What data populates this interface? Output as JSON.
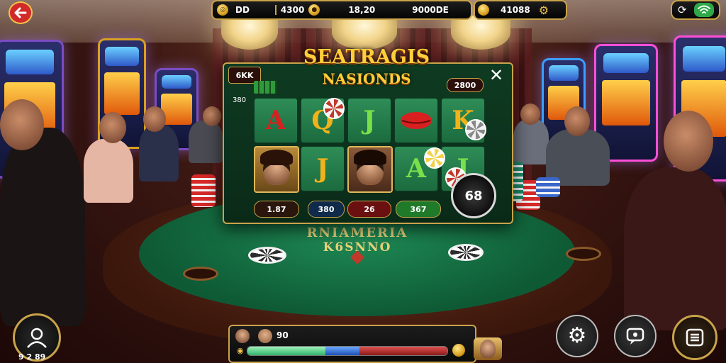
{
  "hud": {
    "top_left_value": "DD",
    "balance_value": "4300",
    "center_value": "18,20",
    "right_value": "9000DE",
    "coins_value": "41088",
    "coin_glyph_1": "◎",
    "coin_glyph_2": "●"
  },
  "slot_panel": {
    "title_line_1": "SEATRAGIS",
    "title_line_2": "NASIONDS",
    "top_left_box": "6KK",
    "top_right_box": "2800",
    "side_number": "380",
    "close_label": "✕",
    "reels_row_1": [
      "A",
      "Q",
      "J",
      "",
      "K"
    ],
    "reels_row_2": [
      "",
      "J",
      "",
      "A",
      "J"
    ],
    "stat_pills": [
      "1.87",
      "380",
      "26",
      "367"
    ],
    "spin_label": "68"
  },
  "table": {
    "felt_line_1": "RNIAMERIA",
    "felt_line_2": "K6SNNO"
  },
  "bottom_bar": {
    "label": "90",
    "progress": {
      "green": 0.39,
      "blue": 0.17,
      "red": 0.44
    }
  },
  "bottom_left": {
    "label": "9 2 89"
  },
  "icons": {
    "back": "back-arrow-icon",
    "settings_top": "gear-icon",
    "refresh": "refresh-icon",
    "wifi": "wifi-icon",
    "profile": "avatar-icon",
    "settings_bottom": "gear-icon",
    "chat": "chat-icon",
    "menu": "menu-icon"
  },
  "colors": {
    "gold": "#c9a34a",
    "felt": "#1f8a55",
    "panel": "#0f3b22",
    "accent_red": "#d62828"
  }
}
